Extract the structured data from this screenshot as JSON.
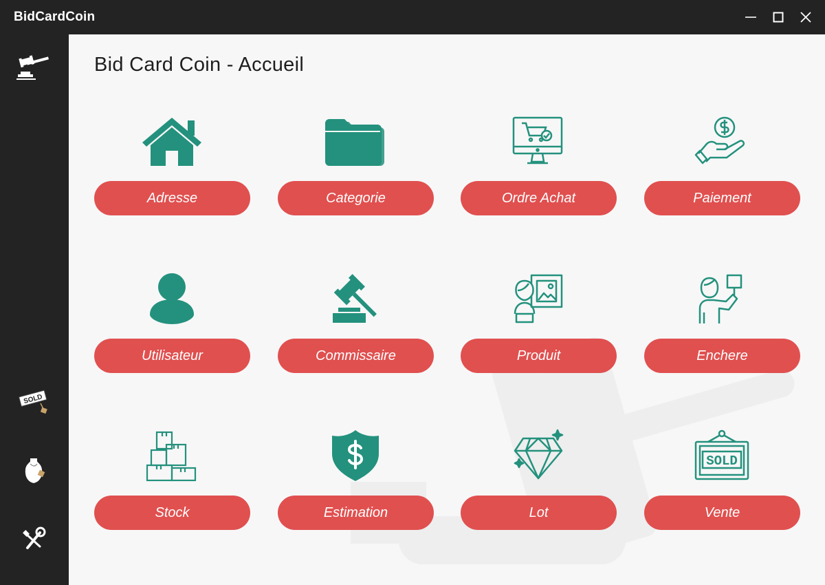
{
  "app": {
    "title": "BidCardCoin",
    "window_controls": [
      {
        "name": "minimize",
        "icon": "minimize-icon"
      },
      {
        "name": "maximize",
        "icon": "maximize-icon"
      },
      {
        "name": "close",
        "icon": "close-icon"
      }
    ]
  },
  "sidebar": {
    "items": [
      {
        "icon": "gavel-icon"
      },
      {
        "icon": "sold-sign-icon"
      },
      {
        "icon": "vase-icon"
      },
      {
        "icon": "wrench-icon"
      }
    ]
  },
  "page": {
    "title": "Bid Card Coin - Accueil"
  },
  "tiles": [
    {
      "label": "Adresse",
      "icon": "house-icon"
    },
    {
      "label": "Categorie",
      "icon": "folder-icon"
    },
    {
      "label": "Ordre Achat",
      "icon": "monitor-cart-icon"
    },
    {
      "label": "Paiement",
      "icon": "hand-dollar-icon"
    },
    {
      "label": "Utilisateur",
      "icon": "user-icon"
    },
    {
      "label": "Commissaire",
      "icon": "gavel-icon"
    },
    {
      "label": "Produit",
      "icon": "portrait-painting-icon"
    },
    {
      "label": "Enchere",
      "icon": "bidder-paddle-icon"
    },
    {
      "label": "Stock",
      "icon": "boxes-icon"
    },
    {
      "label": "Estimation",
      "icon": "shield-dollar-icon"
    },
    {
      "label": "Lot",
      "icon": "diamond-icon"
    },
    {
      "label": "Vente",
      "icon": "sold-sign-icon"
    }
  ],
  "colors": {
    "titlebar": "#232323",
    "sidebar": "#232323",
    "background": "#f7f7f7",
    "accent_button": "#e0504f",
    "icon_teal": "#23917d"
  }
}
